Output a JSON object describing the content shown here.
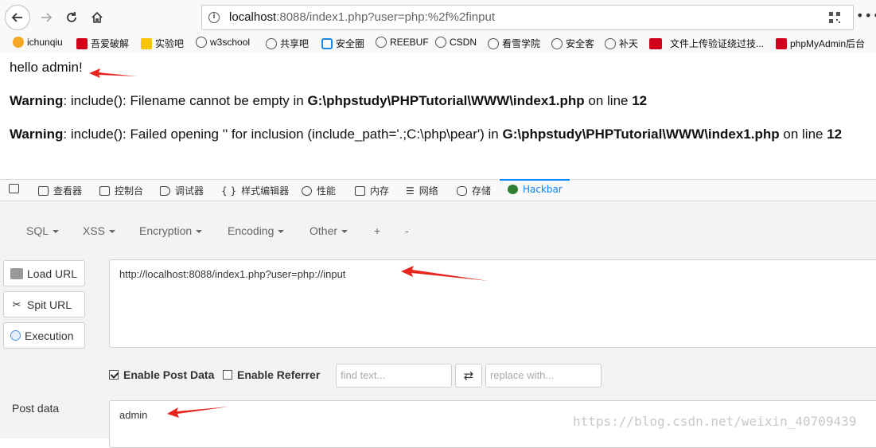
{
  "browser": {
    "url_host": "localhost",
    "url_rest": ":8088/index1.php?user=php:%2f%2finput",
    "info_icon_glyph": "i",
    "menu_glyph": "•••"
  },
  "bookmarks": [
    {
      "label": "ichunqiu",
      "icon": "ichunqiu-icon",
      "color": "#f5a623"
    },
    {
      "label": "吾爱破解",
      "icon": "52pojie-icon",
      "color": "#d0021b"
    },
    {
      "label": "实验吧",
      "icon": "shiyanba-icon",
      "color": "#f8c300"
    },
    {
      "label": "w3school",
      "icon": "globe-icon",
      "color": "#555555"
    },
    {
      "label": "共享吧",
      "icon": "globe-icon",
      "color": "#555555"
    },
    {
      "label": "安全圈",
      "icon": "s-logo-icon",
      "color": "#1e88e5"
    },
    {
      "label": "REEBUF",
      "icon": "globe-icon",
      "color": "#555555"
    },
    {
      "label": "CSDN",
      "icon": "globe-icon",
      "color": "#555555"
    },
    {
      "label": "看雪学院",
      "icon": "globe-icon",
      "color": "#555555"
    },
    {
      "label": "安全客",
      "icon": "globe-icon",
      "color": "#555555"
    },
    {
      "label": "补天",
      "icon": "globe-icon",
      "color": "#555555"
    },
    {
      "label": "文件上传验证绕过技...",
      "icon": "csdn-c-icon",
      "color": "#d0021b"
    },
    {
      "label": "phpMyAdmin后台",
      "icon": "csdn-c-icon",
      "color": "#d0021b"
    }
  ],
  "page": {
    "hello": "hello admin!",
    "warning_label": "Warning",
    "warn1_text": ": include(): Filename cannot be empty in ",
    "warn1_path": "G:\\phpstudy\\PHPTutorial\\WWW\\index1.php",
    "on_line": " on line ",
    "line_no": "12",
    "warn2_text": ": include(): Failed opening '' for inclusion (include_path='.;C:\\php\\pear') in ",
    "warn2_path": "G:\\phpstudy\\PHPTutorial\\WWW\\index1.php"
  },
  "devtools": {
    "tabs": [
      "查看器",
      "控制台",
      "调试器",
      "样式编辑器",
      "性能",
      "内存",
      "网络",
      "存储",
      "Hackbar"
    ],
    "active_tab": "Hackbar",
    "accent_color": "#0a84ff"
  },
  "hackbar": {
    "menus": [
      "SQL",
      "XSS",
      "Encryption",
      "Encoding",
      "Other"
    ],
    "plus": "+",
    "minus": "-",
    "load_url": "Load URL",
    "split_url": "Spit URL",
    "execution": "Execution",
    "url_value": "http://localhost:8088/index1.php?user=php://input",
    "enable_post": "Enable Post Data",
    "enable_post_checked": true,
    "enable_referrer": "Enable Referrer",
    "enable_referrer_checked": false,
    "find_placeholder": "find text...",
    "replace_placeholder": "replace with...",
    "swap_glyph": "⇄",
    "post_label": "Post data",
    "post_value": "admin"
  },
  "watermark": "https://blog.csdn.net/weixin_40709439",
  "annotation_color": "#e8231c"
}
